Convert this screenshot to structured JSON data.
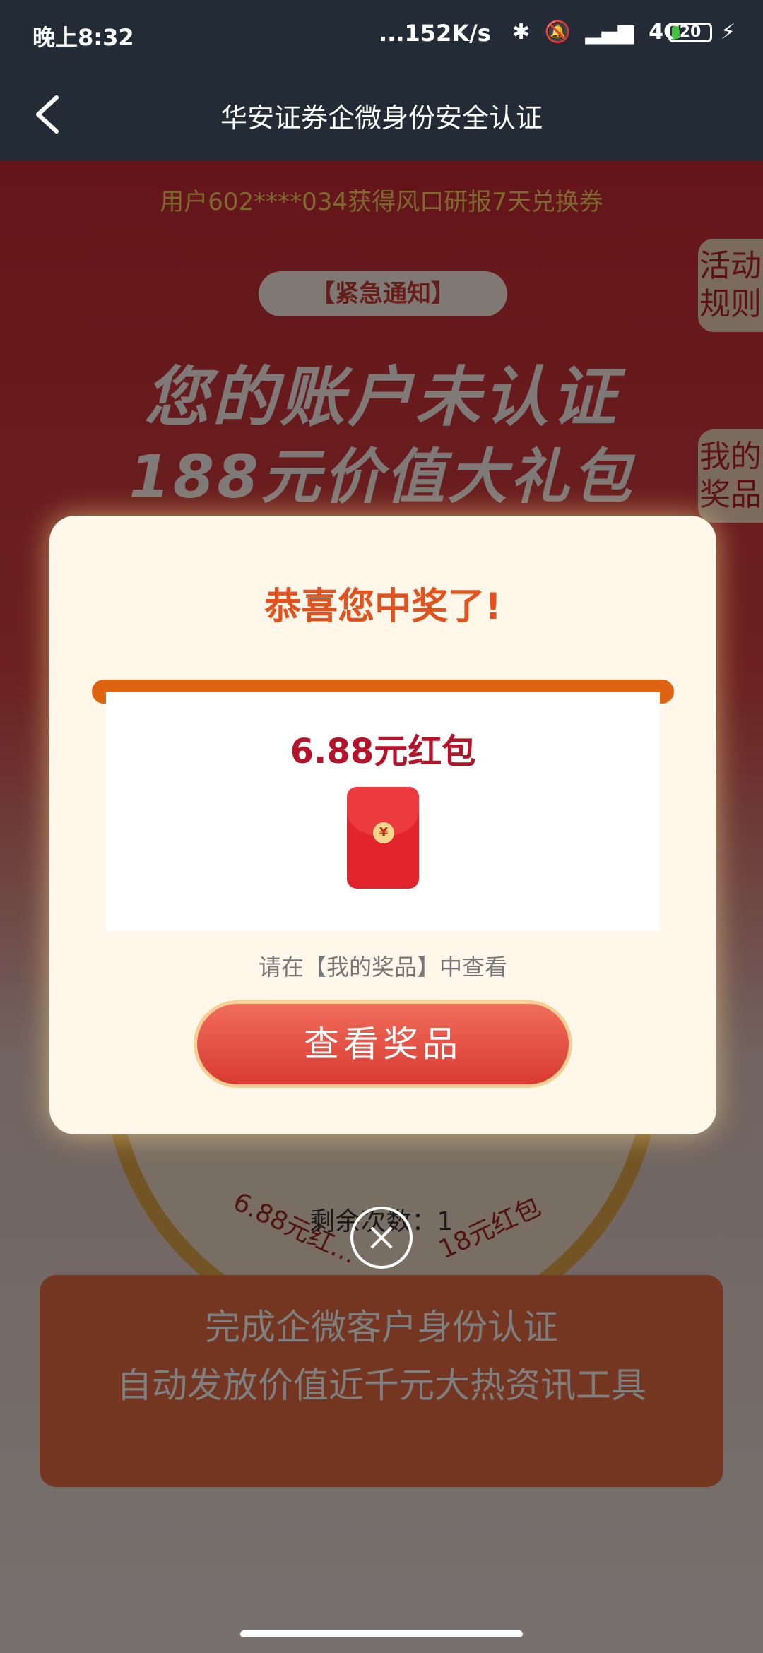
{
  "status": {
    "time": "晚上8:32",
    "net_speed": "...152K/s",
    "network": "4G",
    "battery": "20",
    "battery_level_pct": 20
  },
  "nav": {
    "title": "华安证券企微身份安全认证"
  },
  "background": {
    "ticker": "用户602****034获得风口研报7天兑换券",
    "side_tabs": [
      "活动规则",
      "我的奖品"
    ],
    "notice_pill": "【紧急通知】",
    "headline1": "您的账户未认证",
    "headline2": "188元价值大礼包",
    "wheel_labels": [
      "6.88元红…",
      "18元红包"
    ],
    "remaining": "剩余次数：1",
    "promo_line1": "完成企微客户身份认证",
    "promo_line2": "自动发放价值近千元大热资讯工具"
  },
  "modal": {
    "title": "恭喜您中奖了!",
    "prize_name": "6.88元红包",
    "envelope_symbol": "¥",
    "hint": "请在【我的奖品】中查看",
    "button": "查看奖品"
  },
  "colors": {
    "accent": "#e2521f",
    "prize_text": "#b5132a",
    "button": "#d83a30"
  }
}
